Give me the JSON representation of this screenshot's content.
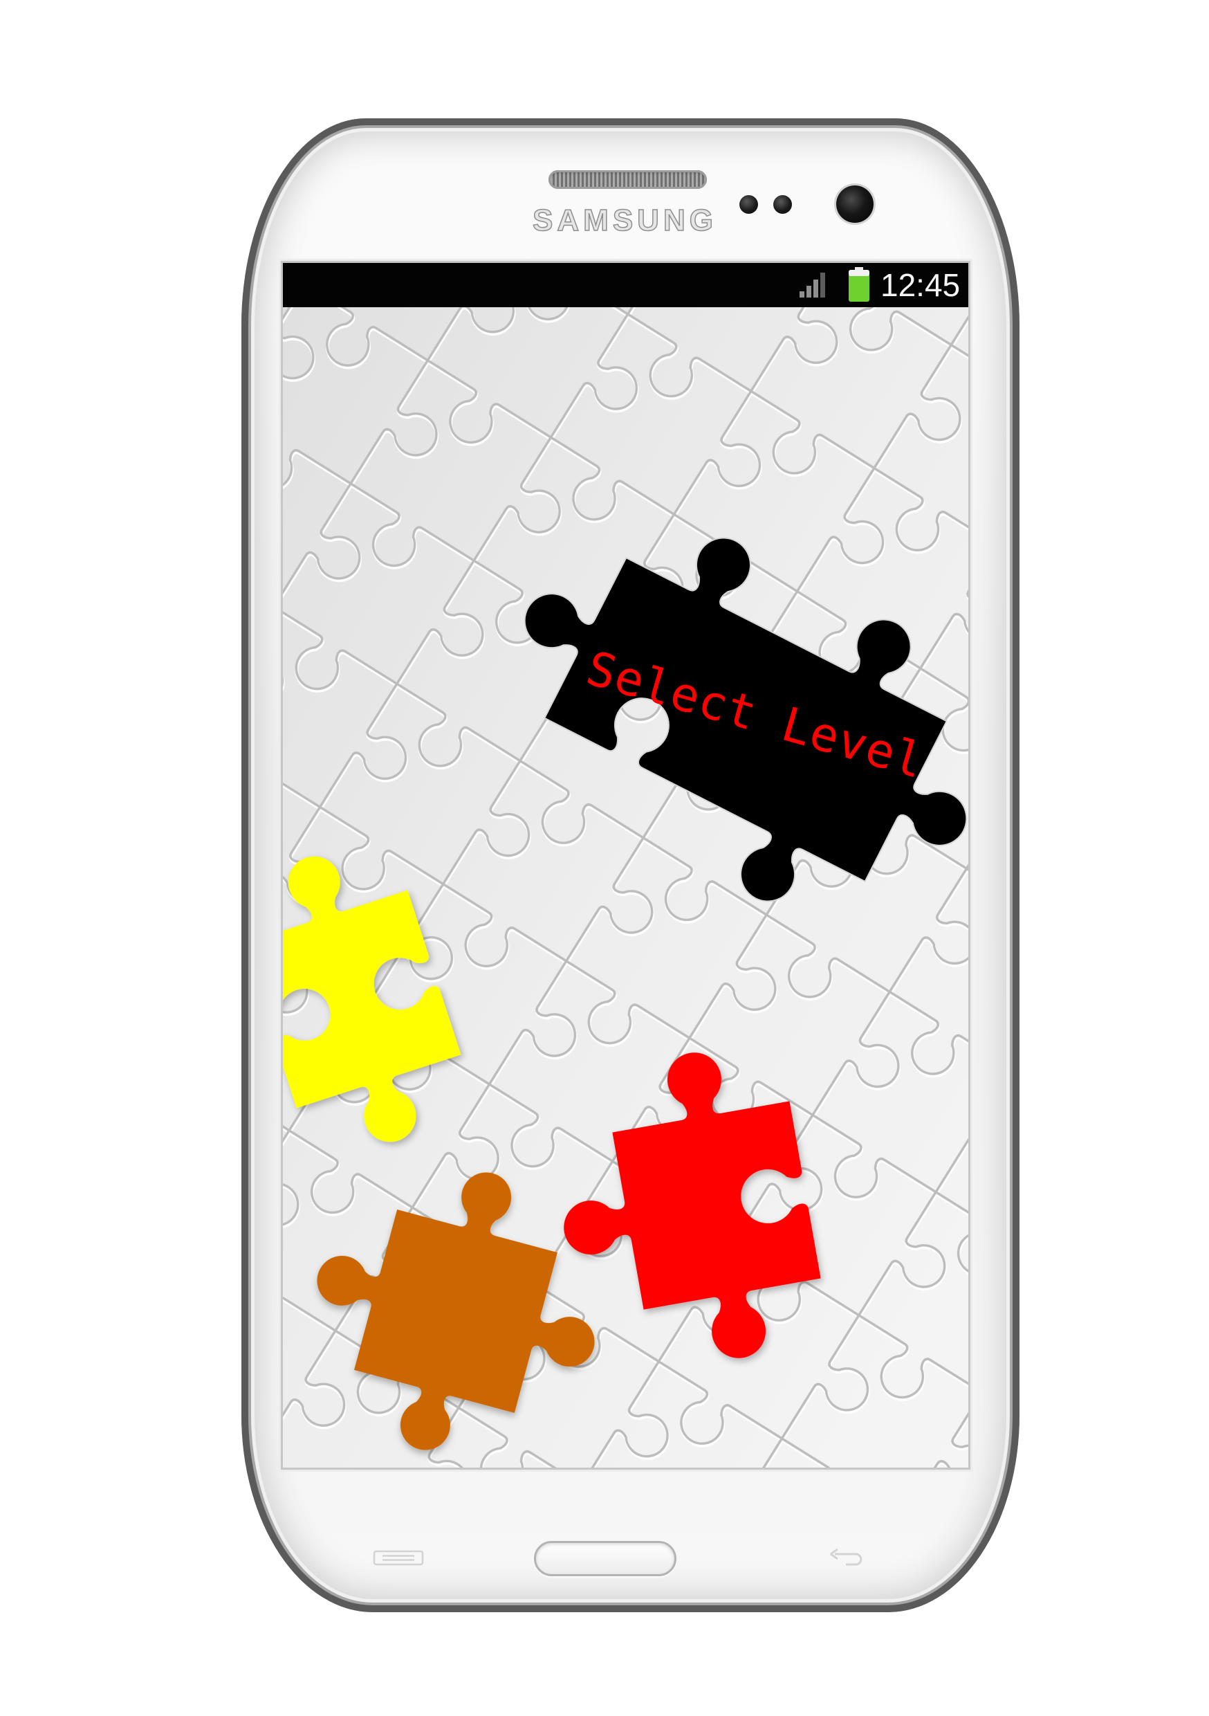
{
  "device": {
    "brand": "SAMSUNG"
  },
  "status_bar": {
    "time": "12:45",
    "icons": {
      "signal": "signal-icon",
      "battery": "battery-icon"
    },
    "battery_color": "#6fd12e"
  },
  "level_screen": {
    "title": "Select Level",
    "title_color": "#ff0000",
    "piece_colors": {
      "black": "#000000",
      "yellow": "#ffff00",
      "red": "#ff0000",
      "brown": "#cc6600"
    }
  },
  "hardware_keys": {
    "menu": "menu-key-icon",
    "home": "home-button",
    "back": "back-key-icon"
  }
}
